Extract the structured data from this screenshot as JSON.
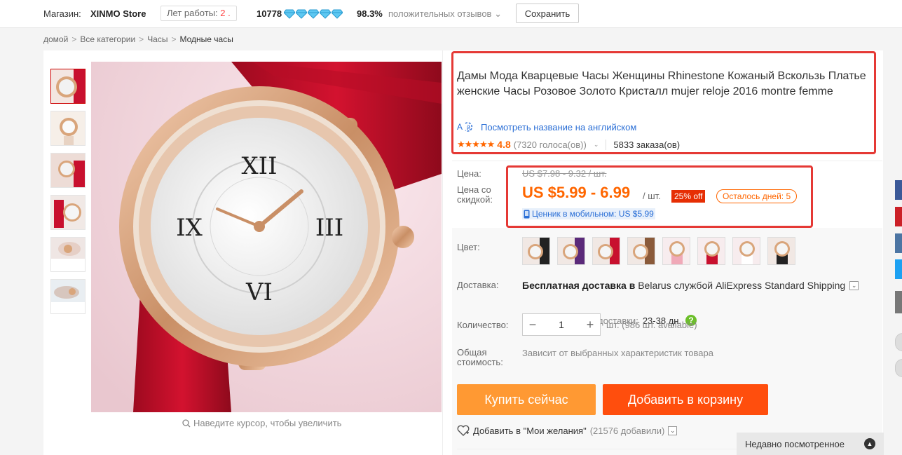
{
  "store": {
    "label": "Магазин:",
    "name": "XINMO Store",
    "years_label": "Лет работы:",
    "years_value": "2 .",
    "score": "10778",
    "diamond_count": 5,
    "positive_pct": "98.3%",
    "positive_label": "положительных отзывов",
    "positive_caret": "⌄",
    "save_label": "Сохранить"
  },
  "breadcrumb": {
    "items": [
      "домой",
      "Все категории",
      "Часы",
      "Модные часы"
    ],
    "separator": ">"
  },
  "gallery": {
    "thumb_count": 6,
    "zoom_hint": "Наведите курсор, чтобы увеличить"
  },
  "product": {
    "title": "Дамы Мода Кварцевые Часы Женщины Rhinestone Кожаный Вскользь Платье женские Часы Розовое Золото Кристалл mujer reloje 2016 montre femme",
    "translate_icon": "translate-icon",
    "translate_label": "Посмотреть название на английском",
    "stars": "★★★★★",
    "rating": "4.8",
    "votes": "(7320 голоса(ов))",
    "caret": "⌄",
    "orders": "5833 заказа(ов)"
  },
  "price": {
    "price_label": "Цена:",
    "old_price": "US $7.98 - 9.32 / шт.",
    "discount_label": "Цена со скидкой:",
    "price": "US $5.99 - 6.99",
    "unit": "/ шт.",
    "discount_badge": "25% off",
    "days_left": "Осталось дней: 5",
    "mobile_price": "Ценник в мобильном: US $5.99"
  },
  "options": {
    "color_label": "Цвет:",
    "color_swatches": 8,
    "shipping_label": "Доставка:",
    "shipping_free": "Бесплатная доставка в",
    "shipping_rest": "Belarus службой AliExpress Standard Shipping",
    "delivery_label": "Расчётное время доставки:",
    "delivery_value": "23-38 дн.",
    "help_glyph": "?",
    "quantity_label": "Количество:",
    "quantity_minus": "−",
    "quantity_plus": "+",
    "quantity_value": "1",
    "available": "шт. (986 шт. available)",
    "total_label": "Общая стоимость:",
    "total_value": "Зависит от выбранных характеристик товара"
  },
  "actions": {
    "buy_now": "Купить сейчас",
    "add_to_cart": "Добавить в корзину",
    "wishlist": "Добавить в \"Мои желания\"",
    "wishlist_count": "(21576 добавили)"
  },
  "recent": {
    "label": "Недавно посмотренное",
    "toggle_glyph": "▲"
  },
  "colors": {
    "accent_orange": "#ff6600",
    "buy_button": "#ff9933",
    "cart_button": "#ff4e0d",
    "link_blue": "#2b6fd6",
    "highlight_red": "#e53935",
    "leather_red": "#c8102e",
    "rose_gold": "#d9a57b"
  }
}
